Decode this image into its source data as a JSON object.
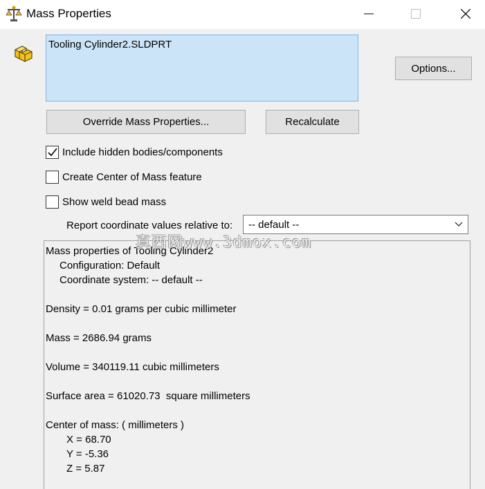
{
  "window": {
    "title": "Mass Properties",
    "icons": {
      "app": "mass-properties-icon",
      "minimize": "minimize-icon",
      "maximize": "maximize-icon",
      "close": "close-icon"
    }
  },
  "parts_list": {
    "part_icon": "part-icon",
    "selected_item": "Tooling Cylinder2.SLDPRT"
  },
  "buttons": {
    "options": "Options...",
    "override": "Override Mass Properties...",
    "recalculate": "Recalculate"
  },
  "checkboxes": [
    {
      "label": "Include hidden bodies/components",
      "checked": true
    },
    {
      "label": "Create Center of Mass feature",
      "checked": false
    },
    {
      "label": "Show weld bead mass",
      "checked": false
    }
  ],
  "coordinate": {
    "label": "Report coordinate values relative to:",
    "selected": "-- default --"
  },
  "results": {
    "header": "Mass properties of Tooling Cylinder2",
    "configuration": "Configuration: Default",
    "coordinate_system": "Coordinate system: -- default --",
    "density": "Density = 0.01 grams per cubic millimeter",
    "mass": "Mass = 2686.94 grams",
    "volume": "Volume = 340119.11 cubic millimeters",
    "surface_area": "Surface area = 61020.73  square millimeters",
    "center_of_mass": "Center of mass: ( millimeters )",
    "x": "X = 68.70",
    "y": "Y = -5.36",
    "z": "Z = 5.87"
  },
  "watermark": "真西网www.3dmox.com",
  "colors": {
    "selection_bg": "#cce4f7",
    "selection_border": "#7eb4ea",
    "dialog_bg": "#f0f0f0",
    "button_bg": "#e1e1e1"
  }
}
